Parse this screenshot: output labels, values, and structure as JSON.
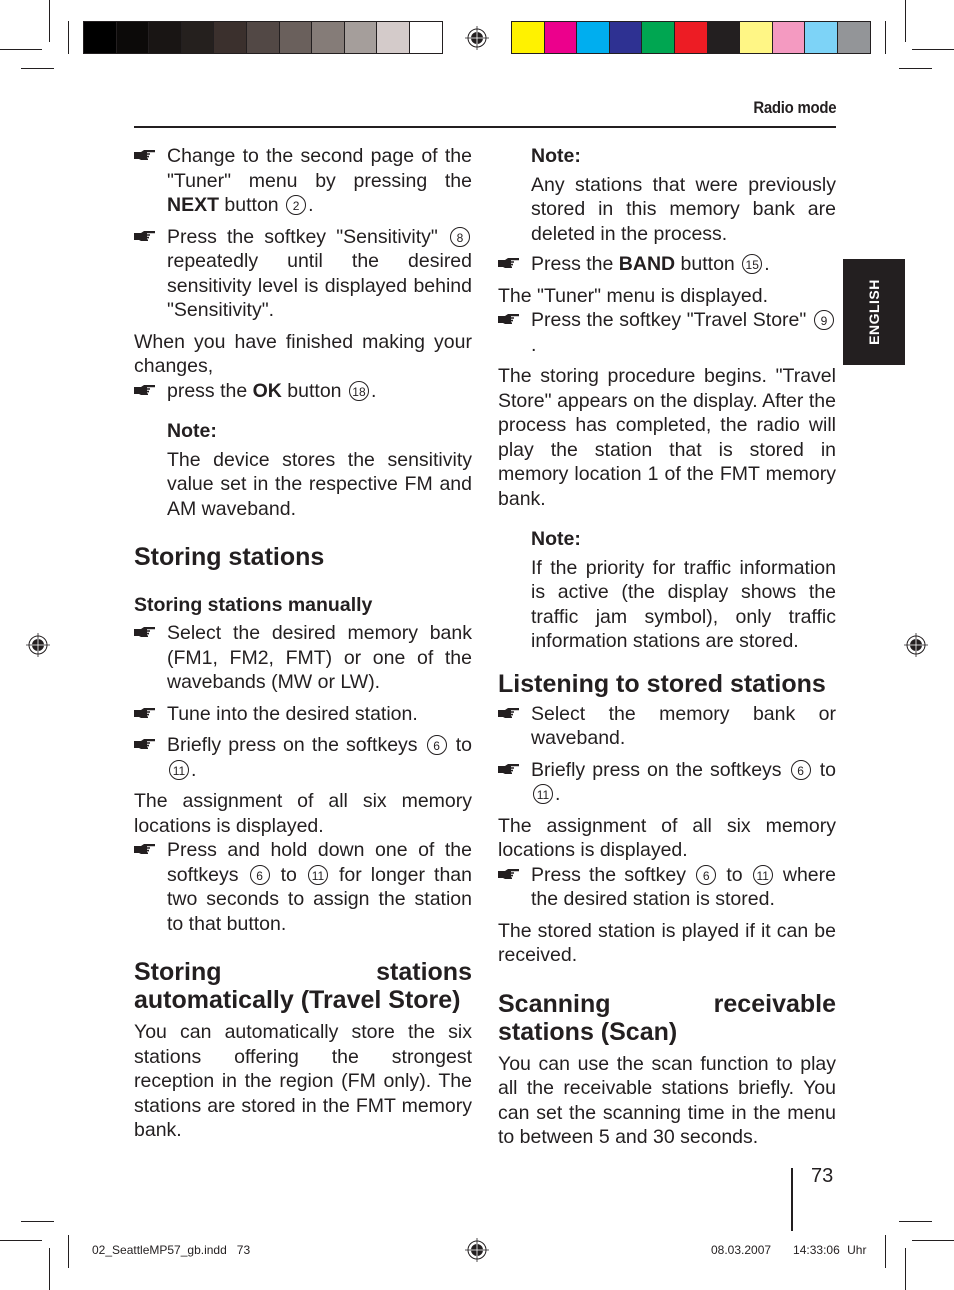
{
  "header": {
    "section_title": "Radio mode",
    "language_tab": "ENGLISH"
  },
  "color_bars": {
    "grayscale": [
      "#000000",
      "#0c0a09",
      "#191514",
      "#25201e",
      "#3b302d",
      "#524845",
      "#6a605c",
      "#857c78",
      "#a59e9b",
      "#d4cbca",
      "#ffffff"
    ],
    "process": [
      "#fff200",
      "#ec008c",
      "#00aeef",
      "#2e3192",
      "#00a651",
      "#ed1c24",
      "#231f20",
      "#fff685",
      "#f49ac1",
      "#7dd3f7",
      "#939598"
    ]
  },
  "left_column": {
    "step1": {
      "pre": "Change to the second page of the \"Tuner\" menu by pressing the ",
      "bold": "NEXT",
      "post1": " button ",
      "num": "2",
      "post2": "."
    },
    "step2": {
      "pre": "Press the softkey \"Sensitivity\" ",
      "num": "8",
      "post": " repeatedly until the desired sensitivity level is displayed behind \"Sensitivity\"."
    },
    "para1": "When you have finished making your changes,",
    "step3": {
      "pre": "press the ",
      "bold": "OK",
      "post1": " button ",
      "num": "18",
      "post2": "."
    },
    "note1": {
      "label": "Note:",
      "text": "The device stores the sensitivity value set in the respective FM and AM waveband."
    },
    "heading_storing": "Storing stations",
    "subheading_manual": "Storing stations manually",
    "step4": "Select the desired memory bank (FM1, FM2, FMT) or one of the wavebands (MW or LW).",
    "step5": "Tune into the desired station.",
    "step6": {
      "pre": "Briefly press on the softkeys ",
      "num1": "6",
      "mid": " to ",
      "num2": "11",
      "post": "."
    },
    "para2": "The assignment of all six memory locations is displayed.",
    "step7": {
      "pre": "Press and hold down one of the softkeys ",
      "num1": "6",
      "mid": " to ",
      "num2": "11",
      "post": " for longer than two seconds to assign the station to that button."
    },
    "heading_auto": "Storing stations automatically (Travel Store)",
    "para3": "You can automatically store the six stations offering the strongest reception in the region (FM only). The stations are stored in the FMT memory bank."
  },
  "right_column": {
    "note2": {
      "label": "Note:",
      "text": "Any stations that were previously stored in this memory bank are deleted in the process."
    },
    "step1": {
      "pre": "Press the ",
      "bold": "BAND",
      "post1": " button ",
      "num": "15",
      "post2": "."
    },
    "para1": "The \"Tuner\" menu is displayed.",
    "step2": {
      "pre": "Press the softkey \"Travel Store\" ",
      "num": "9",
      "post": "."
    },
    "para2": "The storing procedure begins. \"Travel Store\" appears on the display. After the process has completed, the radio will play the station that is stored in memory location 1 of the FMT memory bank.",
    "note3": {
      "label": "Note:",
      "text": "If the priority for traffic information is active (the display shows the traffic jam symbol), only traffic information stations are stored."
    },
    "heading_listening": "Listening to stored stations",
    "step3": "Select the memory bank or waveband.",
    "step4": {
      "pre": "Briefly press on the softkeys ",
      "num1": "6",
      "mid": " to ",
      "num2": "11",
      "post": "."
    },
    "para3": "The assignment of all six memory locations is displayed.",
    "step5": {
      "pre": "Press the softkey ",
      "num1": "6",
      "mid": " to ",
      "num2": "11",
      "post": " where the desired station is stored."
    },
    "para4": "The stored station is played if it can be received.",
    "heading_scan": "Scanning receivable stations (Scan)",
    "para5": "You can use the scan function to play all the receivable stations briefly. You can set the scanning time in the menu to between 5 and 30 seconds."
  },
  "footer": {
    "page_number": "73",
    "slug_file": "02_SeattleMP57_gb.indd   73",
    "slug_date": "08.03.2007   14:33:06 Uhr"
  }
}
